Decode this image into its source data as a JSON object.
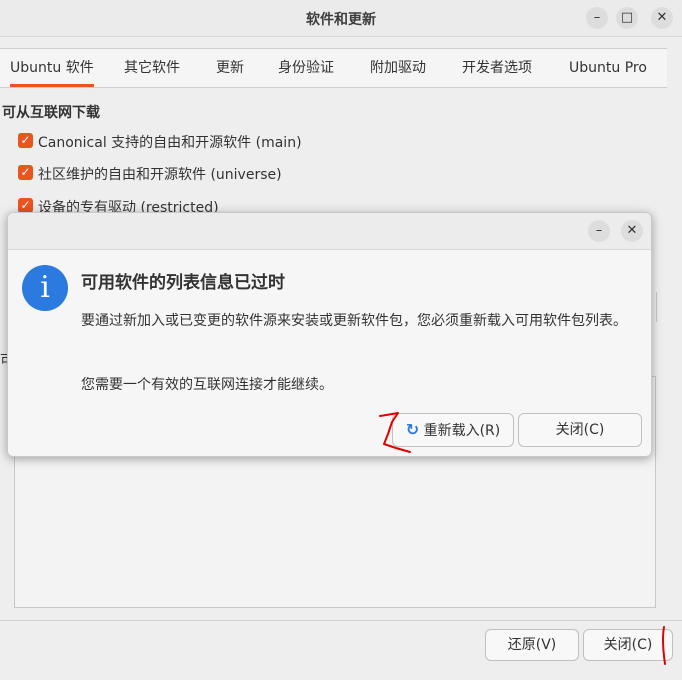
{
  "window": {
    "title": "软件和更新",
    "minimize_glyph": "–",
    "maximize_glyph": "□",
    "close_glyph": "✕"
  },
  "tabs": [
    {
      "label": "Ubuntu 软件",
      "active": true
    },
    {
      "label": "其它软件"
    },
    {
      "label": "更新"
    },
    {
      "label": "身份验证"
    },
    {
      "label": "附加驱动"
    },
    {
      "label": "开发者选项"
    },
    {
      "label": "Ubuntu Pro"
    }
  ],
  "download_section": {
    "title": "可从互联网下载",
    "items": [
      {
        "label": "Canonical 支持的自由和开源软件 (main)",
        "checked": true
      },
      {
        "label": "社区维护的自由和开源软件 (universe)",
        "checked": true
      },
      {
        "label": "设备的专有驱动 (restricted)",
        "checked": true
      }
    ],
    "check_glyph": "✓"
  },
  "background_partial_label": "可",
  "bottom_buttons": {
    "revert": "还原(V)",
    "close": "关闭(C)"
  },
  "dialog": {
    "minimize_glyph": "–",
    "close_glyph": "✕",
    "icon_glyph": "i",
    "heading": "可用软件的列表信息已过时",
    "message1": "要通过新加入或已变更的软件源来安装或更新软件包，您必须重新载入可用软件包列表。",
    "message2": "您需要一个有效的互联网连接才能继续。",
    "reload_glyph": "↻",
    "reload_button": "重新载入(R)",
    "close_button": "关闭(C)"
  },
  "colors": {
    "accent": "#e95420",
    "info": "#2b7ae0",
    "annotation": "#e00000"
  }
}
